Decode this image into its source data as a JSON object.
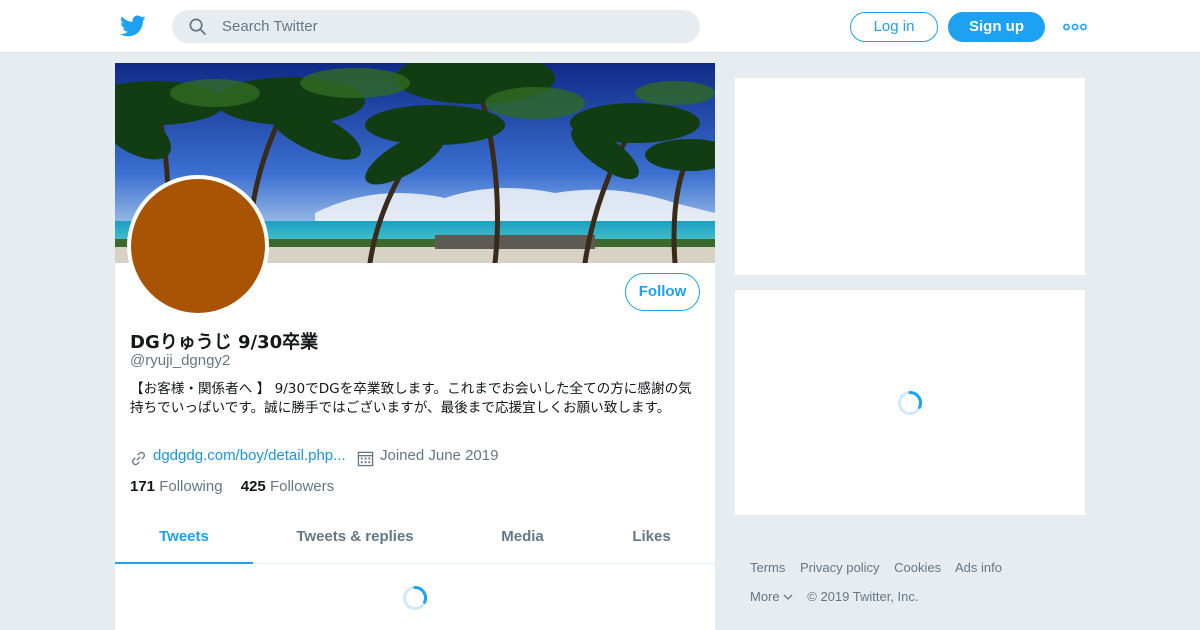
{
  "header": {
    "search_placeholder": "Search Twitter",
    "login_label": "Log in",
    "signup_label": "Sign up",
    "brand_color": "#1da1f2",
    "logo_icon": "twitter-bird-icon",
    "more_icon": "more-dots-icon"
  },
  "profile": {
    "name": "DGりゅうじ 9/30卒業",
    "handle": "@ryuji_dgngy2",
    "bio": "【お客様・関係者へ 】 9/30でDGを卒業致します。これまでお会いした全ての方に感謝の気持ちでいっぱいです。誠に勝手ではございますが、最後まで応援宜しくお願い致します。",
    "website": "dgdgdg.com/boy/detail.php...",
    "joined": "Joined June 2019",
    "following_count": "171",
    "following_label": "Following",
    "followers_count": "425",
    "followers_label": "Followers",
    "follow_label": "Follow",
    "avatar_color": "#a95404"
  },
  "tabs": [
    {
      "label": "Tweets",
      "active": true
    },
    {
      "label": "Tweets & replies",
      "active": false
    },
    {
      "label": "Media",
      "active": false
    },
    {
      "label": "Likes",
      "active": false
    }
  ],
  "footer": {
    "links": [
      "Terms",
      "Privacy policy",
      "Cookies",
      "Ads info"
    ],
    "more_label": "More",
    "copyright": "© 2019 Twitter, Inc."
  }
}
